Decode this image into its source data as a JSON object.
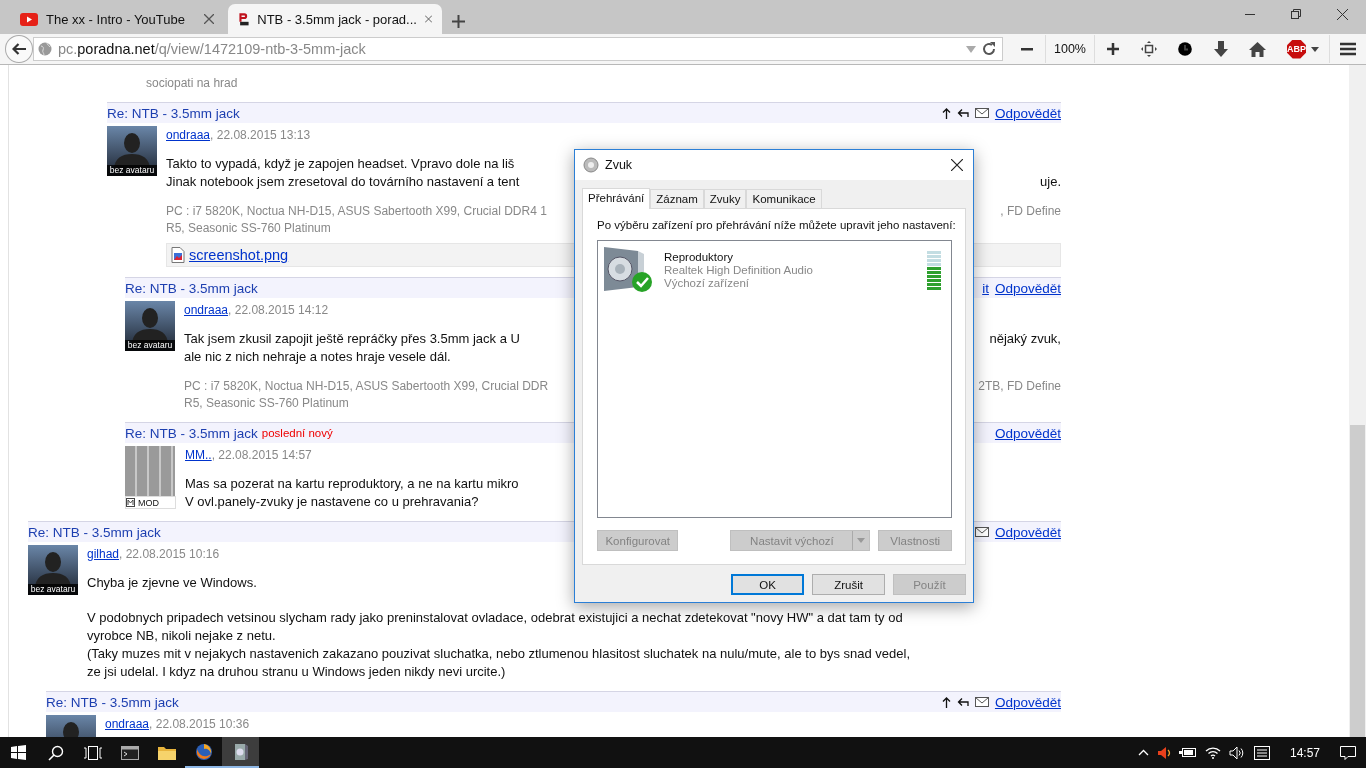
{
  "browser": {
    "tabs": [
      {
        "title": "The xx - Intro - YouTube",
        "kind": "video",
        "selected": false
      },
      {
        "title": "NTB - 3.5mm jack - porad...",
        "kind": "forum",
        "selected": true
      }
    ],
    "address": {
      "subdomain": "pc.",
      "domain": "poradna.net",
      "path": "/q/view/1472109-ntb-3-5mm-jack"
    },
    "zoom": "100%",
    "adblock_label": "ABP"
  },
  "page": {
    "signature_tail": "sociopati na hrad",
    "posts": [
      {
        "title": "Re: NTB - 3.5mm jack",
        "author": "ondraaa",
        "date": ", 22.08.2015 13:13",
        "avatar": {
          "kind": "none",
          "caption": "bez avataru"
        },
        "actions": {
          "up": true,
          "back": true,
          "mail": true,
          "reply": "Odpovědět"
        },
        "paragraphs": [
          [
            {
              "text": "Takto to vypadá, když je zapojen headset. Vpravo dole na liš"
            },
            {
              "left": "Jinak notebook jsem zresetoval do továrního nastavení a tent",
              "right": "uje."
            }
          ]
        ],
        "signature": [
          {
            "left": "PC : i7 5820K, Noctua NH-D15, ASUS Sabertooth X99, Crucial DDR4 1",
            "right": ", FD Define"
          },
          {
            "text": "R5, Seasonic SS-760 Platinum"
          }
        ],
        "attachment": "screenshot.png",
        "children": [
          {
            "title": "Re: NTB - 3.5mm jack",
            "author": "ondraaa",
            "date": ", 22.08.2015 14:12",
            "avatar": {
              "kind": "none",
              "caption": "bez avataru"
            },
            "actions": {
              "fragment": "it",
              "reply": "Odpovědět"
            },
            "paragraphs": [
              [
                {
                  "left": "Tak jsem zkusil zapojit ještě repráčky přes 3.5mm jack a U",
                  "right": "nějaký zvuk,"
                },
                {
                  "text": "ale nic z nich nehraje a notes hraje vesele dál."
                }
              ]
            ],
            "signature": [
              {
                "left": "PC : i7 5820K, Noctua NH-D15, ASUS Sabertooth X99, Crucial DDR",
                "right": "2TB, FD Define"
              },
              {
                "text": "R5, Seasonic SS-760 Platinum"
              }
            ]
          },
          {
            "title": "Re: NTB - 3.5mm jack",
            "badge": "poslední nový",
            "author": "MM..",
            "date": ", 22.08.2015 14:57",
            "avatar": {
              "kind": "image",
              "caption": "MOD"
            },
            "actions": {
              "reply": "Odpovědět"
            },
            "paragraphs": [
              [
                {
                  "text": "Mas sa pozerat na kartu reproduktory, a ne na kartu mikro"
                },
                {
                  "text": "V ovl.panely-zvuky je nastavene co u prehravania?"
                }
              ]
            ]
          }
        ]
      },
      {
        "title": "Re: NTB - 3.5mm jack",
        "author": "gilhad",
        "date": ", 22.08.2015 10:16",
        "avatar": {
          "kind": "none",
          "caption": "bez avataru"
        },
        "actions": {
          "mail": true,
          "reply": "Odpovědět"
        },
        "paragraphs": [
          [
            {
              "text": "Chyba je zjevne ve Windows."
            }
          ],
          [
            {
              "text": "V podobnych pripadech vetsinou slycham rady jako preninstalovat ovladace, odebrat existujici a nechat zdetekovat \"novy HW\" a dat tam ty od"
            },
            {
              "text": "vyrobce NB, nikoli nejake z netu."
            },
            {
              "text": "(Taky muzes mit v nejakych nastavenich zakazano pouzivat sluchatka, nebo ztlumenou hlasitost sluchatek na nulu/mute, ale to bys snad vedel,"
            },
            {
              "text": "ze jsi udelal. I kdyz na druhou stranu u Windows jeden nikdy nevi urcite.)"
            }
          ]
        ],
        "children": [
          {
            "title": "Re: NTB - 3.5mm jack",
            "author": "ondraaa",
            "date": ", 22.08.2015 10:36",
            "avatar": {
              "kind": "none"
            },
            "actions": {
              "up": true,
              "back": true,
              "mail": true,
              "reply": "Odpovědět"
            }
          }
        ]
      }
    ]
  },
  "dialog": {
    "title": "Zvuk",
    "tabs": [
      {
        "label": "Přehrávání",
        "selected": true
      },
      {
        "label": "Záznam",
        "selected": false
      },
      {
        "label": "Zvuky",
        "selected": false
      },
      {
        "label": "Komunikace",
        "selected": false
      }
    ],
    "instruction": "Po výběru zařízení pro přehrávání níže můžete upravit jeho nastavení:",
    "devices": [
      {
        "name": "Reproduktory",
        "driver": "Realtek High Definition Audio",
        "status": "Výchozí zařízení",
        "default": true,
        "level": 0.6
      }
    ],
    "device_buttons": [
      {
        "label": "Konfigurovat",
        "kind": "plain",
        "disabled": true
      },
      {
        "label": "Nastavit výchozí",
        "kind": "split",
        "disabled": true
      },
      {
        "label": "Vlastnosti",
        "kind": "plain",
        "disabled": true
      }
    ],
    "buttons": [
      {
        "label": "OK",
        "default": true,
        "disabled": false
      },
      {
        "label": "Zrušit",
        "default": false,
        "disabled": false
      },
      {
        "label": "Použít",
        "default": false,
        "disabled": true
      }
    ]
  },
  "taskbar": {
    "apps": [
      {
        "kind": "terminal",
        "running": false,
        "selected": false
      },
      {
        "kind": "folder",
        "running": false,
        "selected": false
      },
      {
        "kind": "firefox",
        "running": true,
        "selected": false
      },
      {
        "kind": "sound",
        "running": true,
        "selected": true
      }
    ],
    "clock": "14:57"
  }
}
